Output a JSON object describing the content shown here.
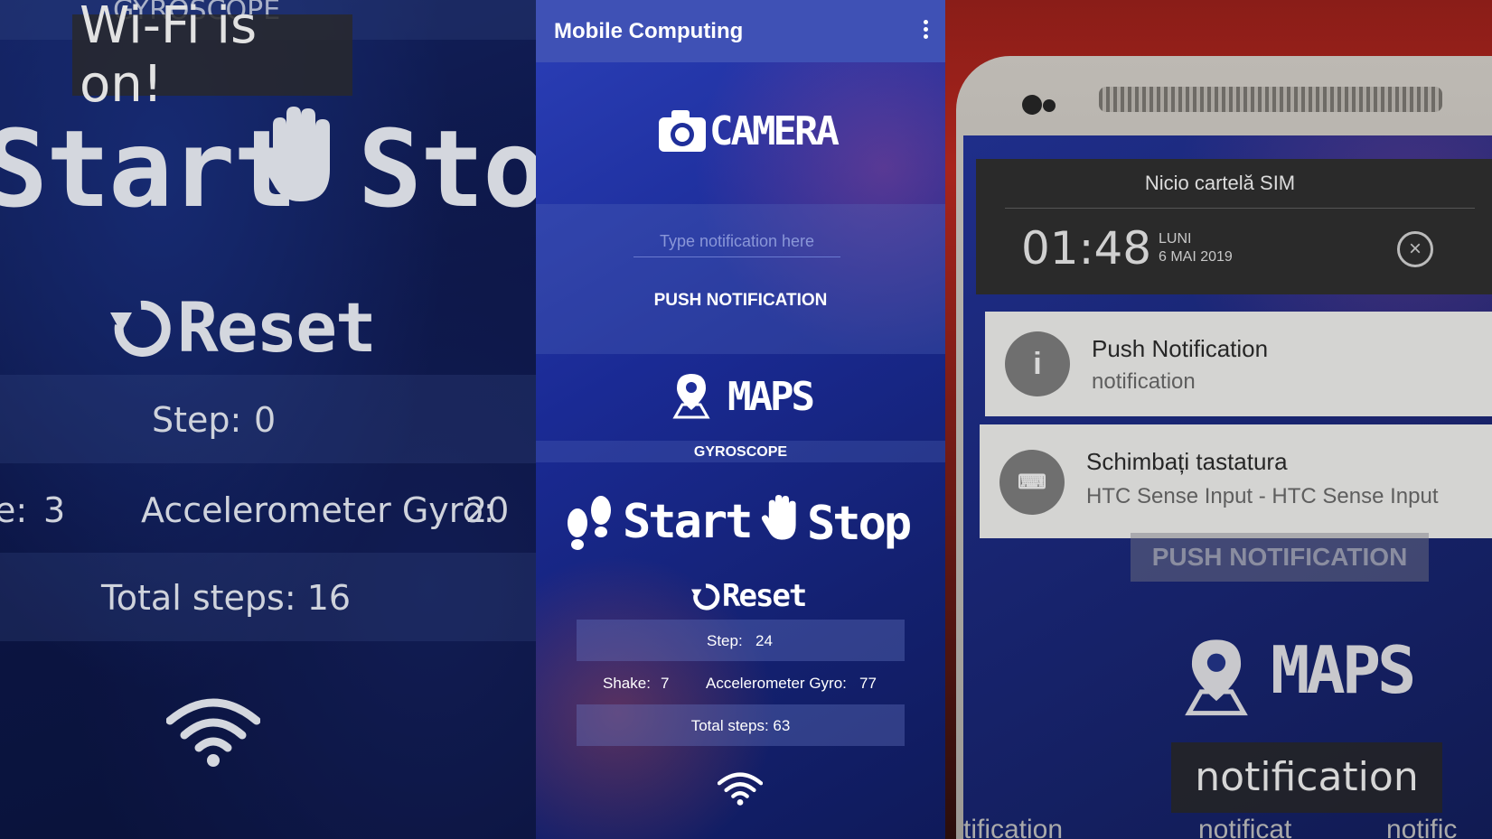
{
  "left_zoom": {
    "toast": "Wi-Fi is on!",
    "cut_header": "GYROSCOPE",
    "start_label": "Start",
    "stop_label": "Stop",
    "reset_label": "Reset",
    "step_label": "Step:",
    "step_value": "0",
    "shake_label": "e:",
    "shake_value": "3",
    "accel_label": "Accelerometer Gyro:",
    "accel_value": "20",
    "total_label": "Total steps: 16",
    "wifi_icon": "wifi-icon"
  },
  "app": {
    "title": "Mobile Computing",
    "camera_label": "CAMERA",
    "notification_placeholder": "Type notification here",
    "push_button": "PUSH NOTIFICATION",
    "maps_label": "MAPS",
    "gyroscope_label": "GYROSCOPE",
    "start_label": "Start",
    "stop_label": "Stop",
    "reset_label": "Reset",
    "step_label": "Step:",
    "step_value": "24",
    "shake_label": "Shake:",
    "shake_value": "7",
    "accel_label": "Accelerometer Gyro:",
    "accel_value": "77",
    "total_label": "Total steps: 63"
  },
  "device_photo": {
    "sim_status": "Nicio cartelă SIM",
    "time": "01:48",
    "day": "LUNI",
    "date": "6 MAI 2019",
    "notifications": [
      {
        "title": "Push Notification",
        "body": "notification",
        "icon": "info-icon"
      },
      {
        "title": "Schimbați tastatura",
        "body": "HTC Sense Input - HTC Sense Input",
        "icon": "keyboard-icon"
      }
    ],
    "bg_push_button": "PUSH NOTIFICATION",
    "bg_maps_label": "MAPS",
    "bg_toast": "notification",
    "bg_toast_trail_1": "tification",
    "bg_toast_trail_2": "notificat",
    "bg_toast_trail_3": "notific"
  }
}
